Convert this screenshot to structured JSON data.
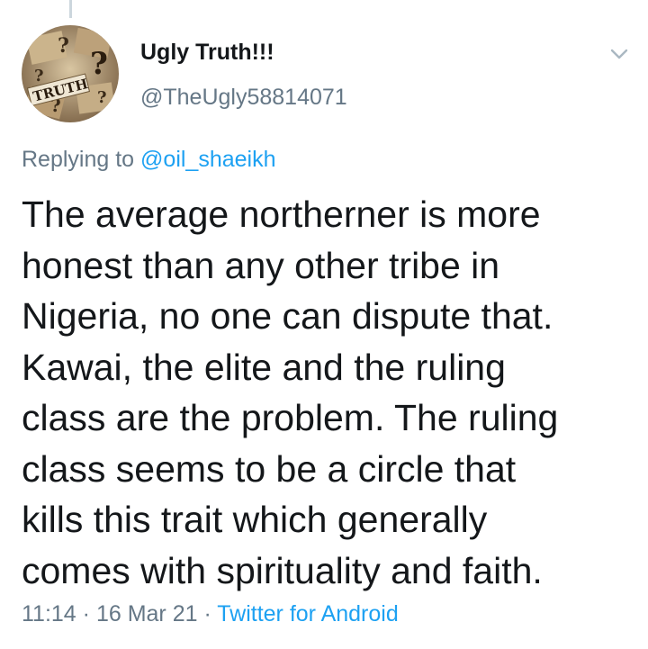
{
  "tweet": {
    "author": {
      "display_name": "Ugly Truth!!!",
      "handle": "@TheUgly58814071",
      "avatar_text": "TRUTH"
    },
    "replying": {
      "prefix": "Replying to ",
      "mention": "@oil_shaeikh"
    },
    "text_lines": [
      "The average northerner is more",
      "honest than any other tribe in",
      "Nigeria, no one can dispute that.",
      "Kawai, the elite and the ruling",
      "class are the problem. The ruling",
      "class seems to be a circle that",
      "kills this trait which generally",
      "comes with spirituality and faith."
    ],
    "meta": {
      "time": "11:14",
      "separator": " · ",
      "date": "16 Mar 21",
      "source": "Twitter for Android"
    },
    "menu_icon": "chevron-down-icon"
  },
  "colors": {
    "text": "#14171a",
    "secondary": "#657786",
    "link": "#1da1f2"
  }
}
